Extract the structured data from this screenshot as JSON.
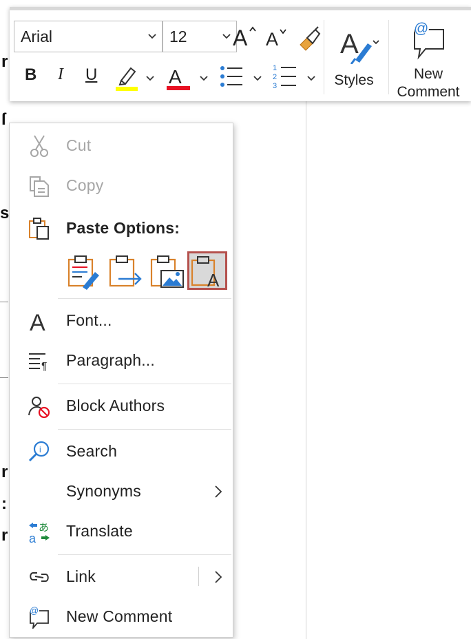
{
  "toolbar": {
    "font_name": "Arial",
    "font_size": "12",
    "styles_label": "Styles",
    "new_comment_line1": "New",
    "new_comment_line2": "Comment",
    "bold": "B",
    "italic": "I",
    "underline": "U",
    "highlight_color": "#ffff00",
    "font_color": "#e81123"
  },
  "menu": {
    "cut": "Cut",
    "copy": "Copy",
    "paste_options": "Paste Options:",
    "font": "Font...",
    "paragraph": "Paragraph...",
    "block_authors": "Block Authors",
    "search": "Search",
    "synonyms": "Synonyms",
    "translate": "Translate",
    "link": "Link",
    "new_comment": "New Comment",
    "paste_opts": [
      {
        "name": "keep-source-formatting",
        "selected": false
      },
      {
        "name": "merge-formatting",
        "selected": false
      },
      {
        "name": "picture",
        "selected": false
      },
      {
        "name": "keep-text-only",
        "selected": true
      }
    ],
    "accent_orange": "#d9822b",
    "accent_blue": "#2b7cd3"
  }
}
